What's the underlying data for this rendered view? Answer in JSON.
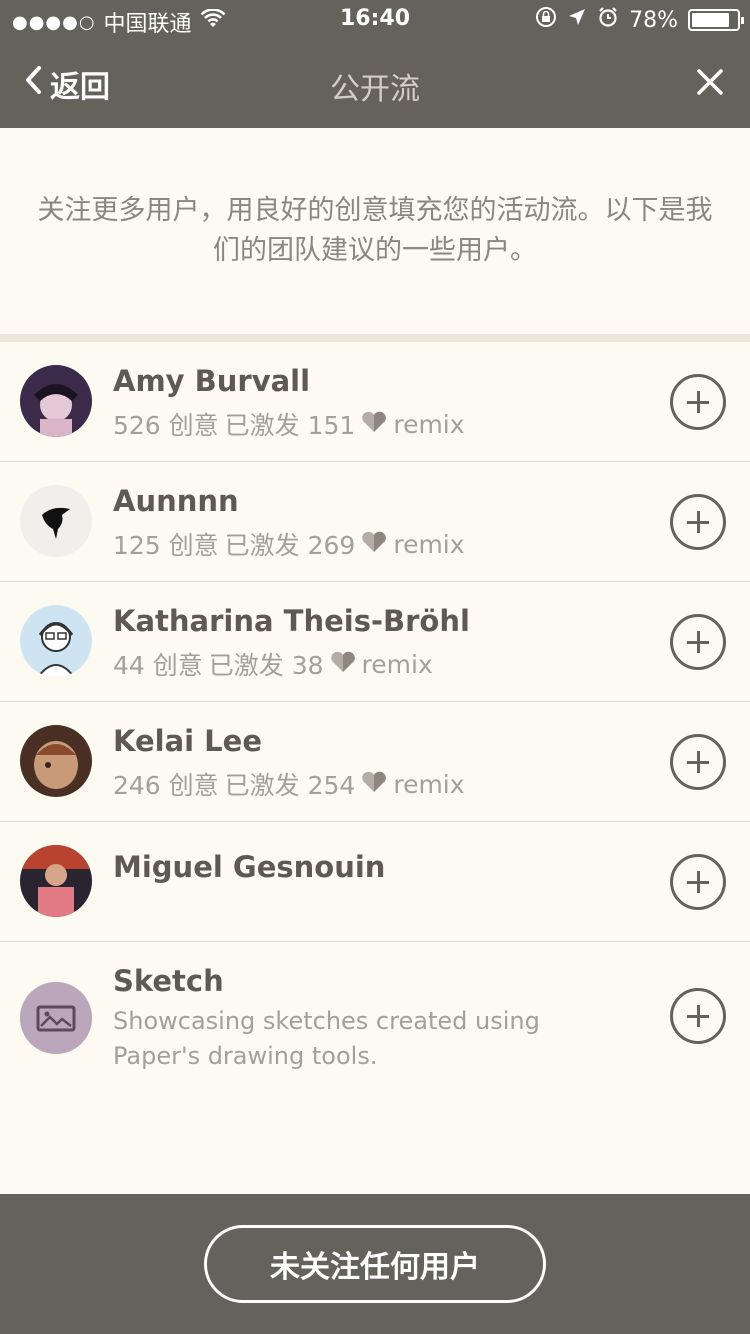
{
  "status_bar": {
    "signal": "●●●●○",
    "carrier": "中国联通",
    "time": "16:40",
    "battery": "78%"
  },
  "nav": {
    "back_label": "返回",
    "title": "公开流"
  },
  "intro": {
    "text": "关注更多用户，用良好的创意填充您的活动流。以下是我们的团队建议的一些用户。"
  },
  "users": [
    {
      "name": "Amy Burvall",
      "ideas": "526 创意",
      "inspired": "已激发 151",
      "remix": "remix"
    },
    {
      "name": "Aunnnn",
      "ideas": "125 创意",
      "inspired": "已激发 269",
      "remix": "remix"
    },
    {
      "name": "Katharina Theis-Bröhl",
      "ideas": "44 创意",
      "inspired": "已激发 38",
      "remix": "remix"
    },
    {
      "name": "Kelai Lee",
      "ideas": "246 创意",
      "inspired": "已激发 254",
      "remix": "remix"
    },
    {
      "name": "Miguel Gesnouin"
    },
    {
      "name": "Sketch",
      "description": "Showcasing sketches created using Paper's drawing tools."
    }
  ],
  "footer": {
    "button_label": "未关注任何用户"
  },
  "colors": {
    "bar": "#65615b",
    "background": "#fdfaf2",
    "text_primary": "#5e5a52",
    "text_secondary": "#a3a097"
  }
}
